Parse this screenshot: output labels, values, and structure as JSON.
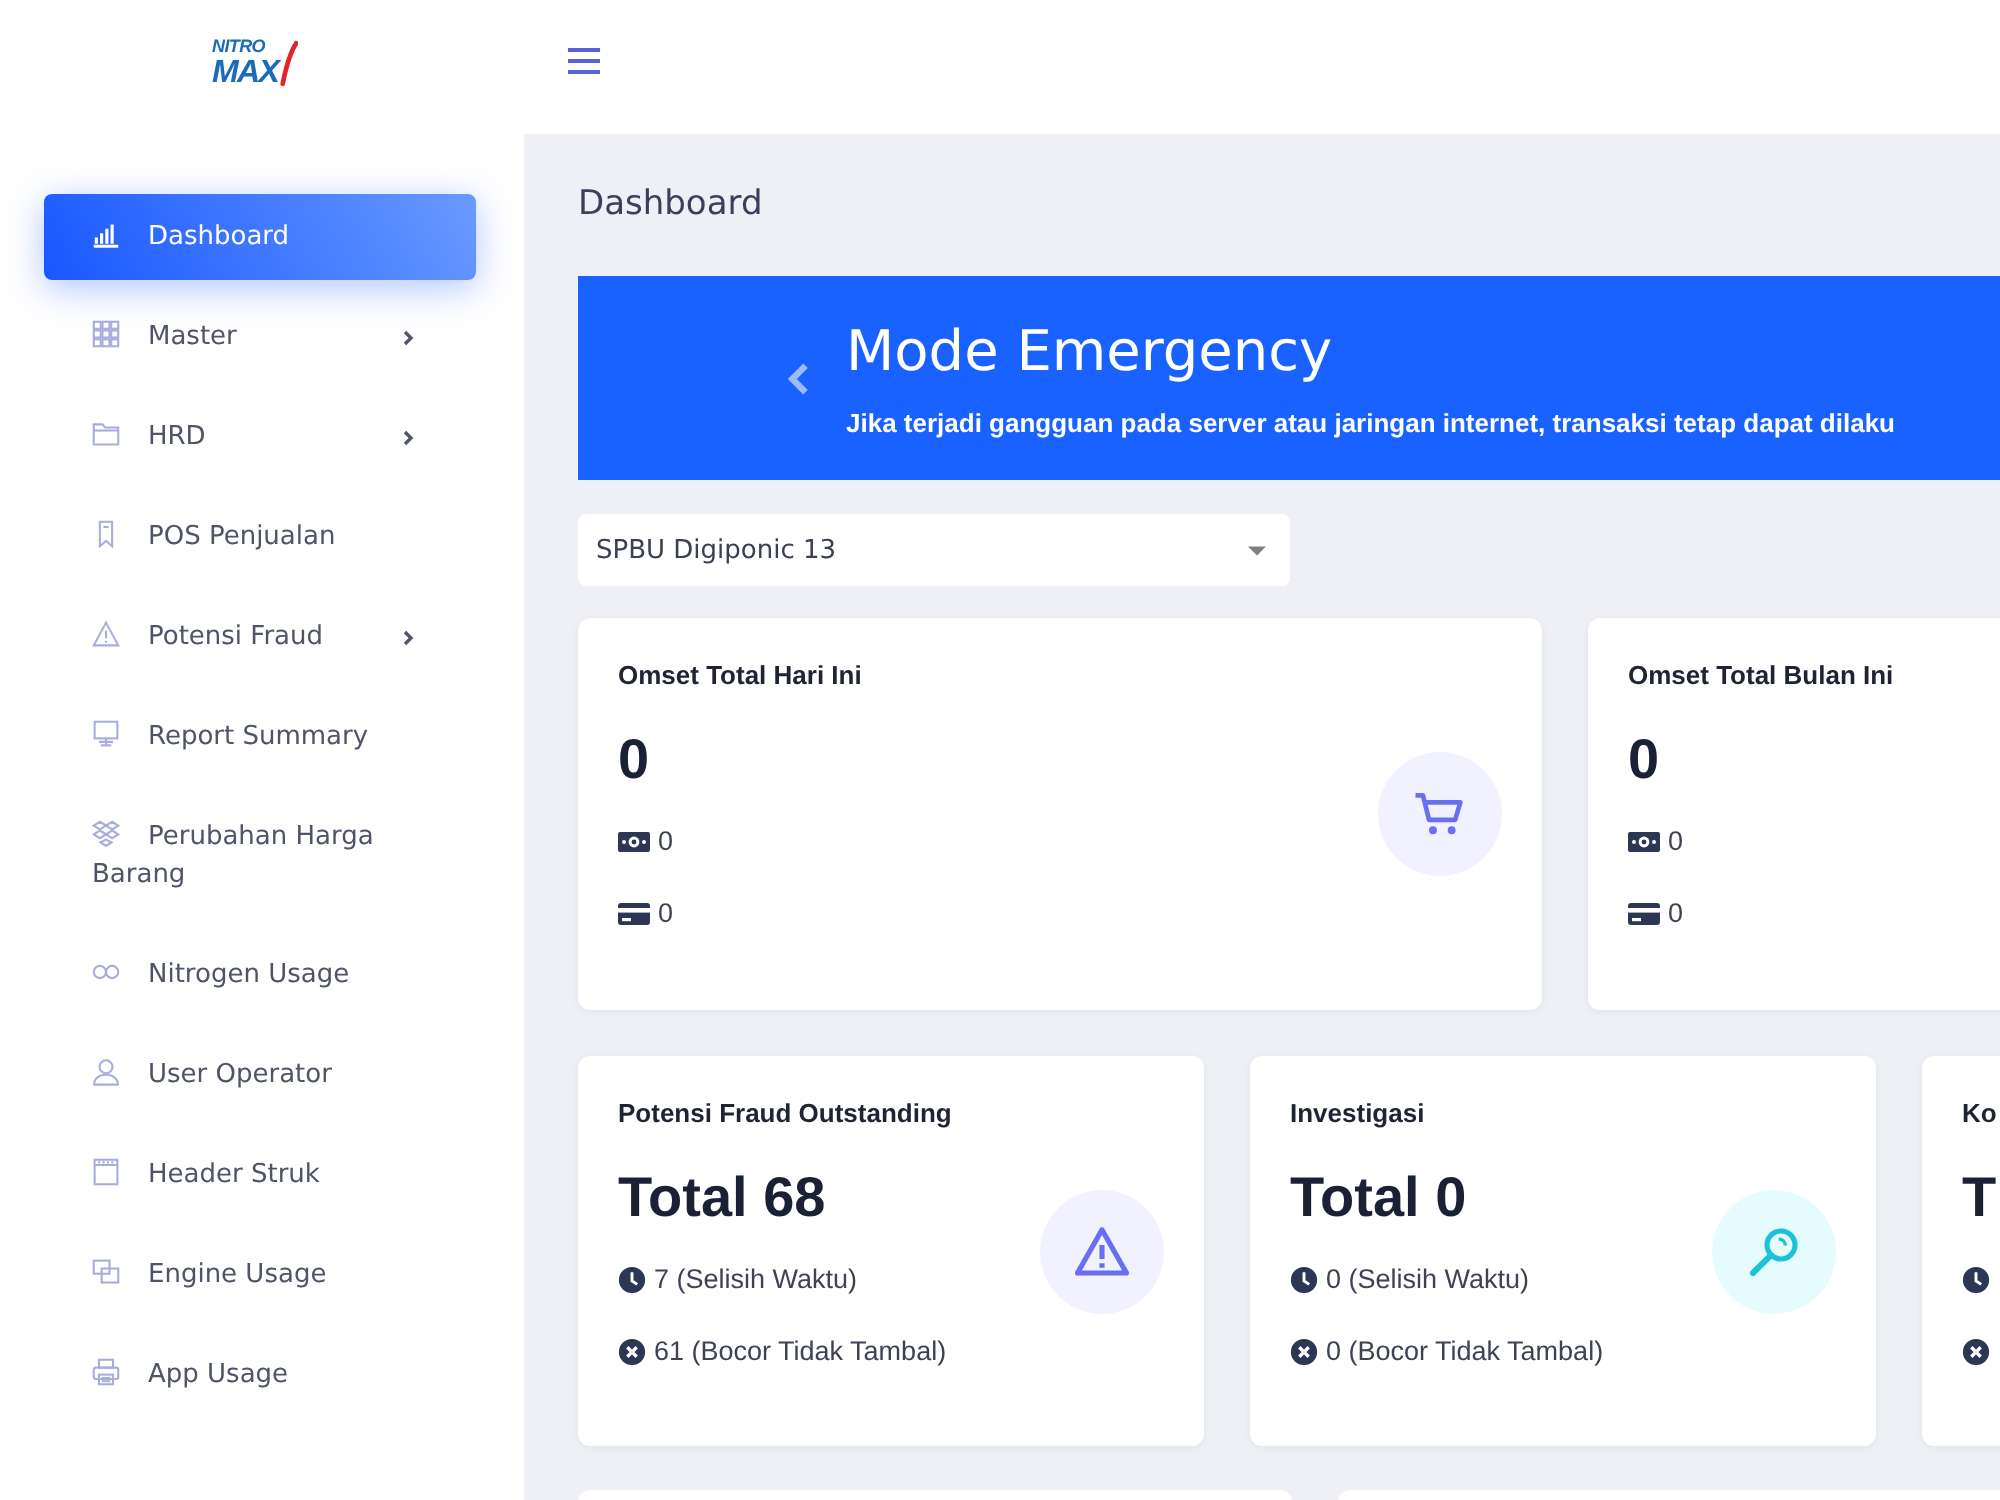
{
  "logo": {
    "top": "NITRO",
    "bottom": "MAX"
  },
  "sidebar": {
    "items": [
      {
        "label": "Dashboard",
        "selected": true,
        "has_submenu": false
      },
      {
        "label": "Master",
        "selected": false,
        "has_submenu": true
      },
      {
        "label": "HRD",
        "selected": false,
        "has_submenu": true
      },
      {
        "label": "POS Penjualan",
        "selected": false,
        "has_submenu": false
      },
      {
        "label": "Potensi Fraud",
        "selected": false,
        "has_submenu": true
      },
      {
        "label": "Report Summary",
        "selected": false,
        "has_submenu": false
      },
      {
        "label": "Perubahan Harga Barang",
        "selected": false,
        "has_submenu": false
      },
      {
        "label": "Nitrogen Usage",
        "selected": false,
        "has_submenu": false
      },
      {
        "label": "User Operator",
        "selected": false,
        "has_submenu": false
      },
      {
        "label": "Header Struk",
        "selected": false,
        "has_submenu": false
      },
      {
        "label": "Engine Usage",
        "selected": false,
        "has_submenu": false
      },
      {
        "label": "App Usage",
        "selected": false,
        "has_submenu": false
      }
    ]
  },
  "page_title": "Dashboard",
  "banner": {
    "title": "Mode Emergency",
    "message": "Jika terjadi gangguan pada server atau jaringan internet, transaksi tetap dapat dilaku"
  },
  "station_select": {
    "value": "SPBU Digiponic 13"
  },
  "revenue_cards": [
    {
      "title": "Omset Total Hari Ini",
      "value": "0",
      "stats": [
        "0",
        "0"
      ]
    },
    {
      "title": "Omset Total Bulan Ini",
      "value": "0",
      "stats": [
        "0",
        "0"
      ]
    }
  ],
  "fraud_cards": [
    {
      "title": "Potensi Fraud Outstanding",
      "value": "Total 68",
      "stats": [
        "7 (Selisih Waktu)",
        "61 (Bocor Tidak Tambal)"
      ]
    },
    {
      "title": "Investigasi",
      "value": "Total 0",
      "stats": [
        "0 (Selisih Waktu)",
        "0 (Bocor Tidak Tambal)"
      ]
    },
    {
      "title": "Ko",
      "value": "T"
    }
  ]
}
